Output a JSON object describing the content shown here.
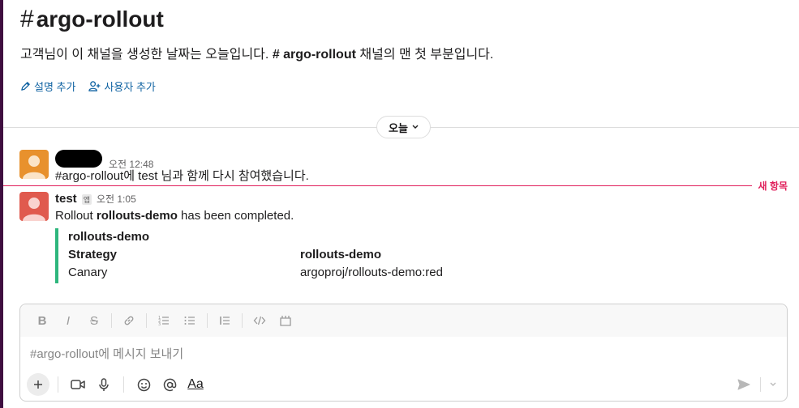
{
  "channel": {
    "hash": "#",
    "name": "argo-rollout"
  },
  "intro": {
    "line_prefix": "고객님이 이 채널을 생성한 날짜는 오늘입니다. ",
    "line_channel": "# argo-rollout",
    "line_suffix": " 채널의 맨 첫 부분입니다.",
    "add_description": "설명 추가",
    "add_people": "사용자 추가"
  },
  "divider": {
    "date_label": "오늘"
  },
  "messages": [
    {
      "time": "오전 12:48",
      "text": "#argo-rollout에 test 님과 함께 다시 참여했습니다.",
      "avatar_color": "#e8912d"
    },
    {
      "name": "test",
      "badge": "앱",
      "time": "오전 1:05",
      "text_prefix": "Rollout ",
      "text_bold": "rollouts-demo",
      "text_suffix": " has been completed.",
      "avatar_color": "#e05a4e",
      "attachment": {
        "title": "rollouts-demo",
        "fields": [
          {
            "label": "Strategy",
            "value": "rollouts-demo"
          },
          {
            "label": "Canary",
            "value": "argoproj/rollouts-demo:red"
          }
        ],
        "color": "#2eb67d"
      }
    }
  ],
  "new_marker": "새 항목",
  "composer": {
    "placeholder": "#argo-rollout에 메시지 보내기",
    "format_bold": "B",
    "format_italic": "I",
    "format_strike": "S",
    "aa": "Aa"
  }
}
